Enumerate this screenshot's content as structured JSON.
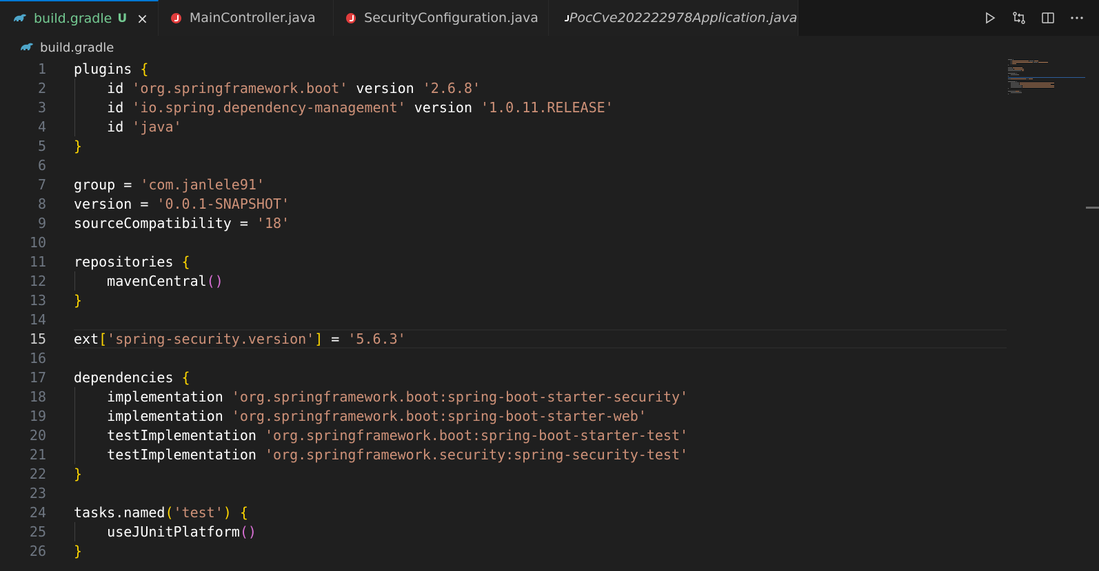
{
  "tabs": [
    {
      "label": "build.gradle",
      "badge": "U",
      "icon": "gradle-icon",
      "active": true,
      "close": "×"
    },
    {
      "label": "MainController.java",
      "icon": "java-icon"
    },
    {
      "label": "SecurityConfiguration.java",
      "icon": "java-icon"
    },
    {
      "label": "PocCve202222978Application.java",
      "icon": "java-icon",
      "italic": true
    }
  ],
  "actions": [
    "run-icon",
    "compare-changes-icon",
    "split-editor-icon",
    "more-actions-icon"
  ],
  "breadcrumb": {
    "file": "build.gradle",
    "icon": "gradle-icon"
  },
  "current_line": 15,
  "colors": {
    "keyword": "#dcdcaa",
    "plain": "#ffffff",
    "string": "#ce9178",
    "brace": "#ffd700",
    "paren": "#da70d6",
    "accent": "#0078d4"
  },
  "lines": [
    {
      "n": "1",
      "tokens": [
        [
          "p",
          "plugins "
        ],
        [
          "b",
          "{"
        ]
      ]
    },
    {
      "n": "2",
      "tokens": [
        [
          "p",
          "    id "
        ],
        [
          "s",
          "'org.springframework.boot'"
        ],
        [
          "p",
          " version "
        ],
        [
          "s",
          "'2.6.8'"
        ]
      ]
    },
    {
      "n": "3",
      "tokens": [
        [
          "p",
          "    id "
        ],
        [
          "s",
          "'io.spring.dependency-management'"
        ],
        [
          "p",
          " version "
        ],
        [
          "s",
          "'1.0.11.RELEASE'"
        ]
      ]
    },
    {
      "n": "4",
      "tokens": [
        [
          "p",
          "    id "
        ],
        [
          "s",
          "'java'"
        ]
      ]
    },
    {
      "n": "5",
      "tokens": [
        [
          "b",
          "}"
        ]
      ]
    },
    {
      "n": "6",
      "tokens": []
    },
    {
      "n": "7",
      "tokens": [
        [
          "p",
          "group = "
        ],
        [
          "s",
          "'com.janlele91'"
        ]
      ]
    },
    {
      "n": "8",
      "tokens": [
        [
          "p",
          "version = "
        ],
        [
          "s",
          "'0.0.1-SNAPSHOT'"
        ]
      ]
    },
    {
      "n": "9",
      "tokens": [
        [
          "p",
          "sourceCompatibility = "
        ],
        [
          "s",
          "'18'"
        ]
      ]
    },
    {
      "n": "10",
      "tokens": []
    },
    {
      "n": "11",
      "tokens": [
        [
          "p",
          "repositories "
        ],
        [
          "b",
          "{"
        ]
      ]
    },
    {
      "n": "12",
      "tokens": [
        [
          "p",
          "    mavenCentral"
        ],
        [
          "q",
          "()"
        ]
      ]
    },
    {
      "n": "13",
      "tokens": [
        [
          "b",
          "}"
        ]
      ]
    },
    {
      "n": "14",
      "tokens": []
    },
    {
      "n": "15",
      "tokens": [
        [
          "p",
          "ext"
        ],
        [
          "b",
          "["
        ],
        [
          "s",
          "'spring-security.version'"
        ],
        [
          "b",
          "]"
        ],
        [
          "p",
          " = "
        ],
        [
          "s",
          "'5.6.3'"
        ]
      ]
    },
    {
      "n": "16",
      "tokens": []
    },
    {
      "n": "17",
      "tokens": [
        [
          "p",
          "dependencies "
        ],
        [
          "b",
          "{"
        ]
      ]
    },
    {
      "n": "18",
      "tokens": [
        [
          "p",
          "    implementation "
        ],
        [
          "s",
          "'org.springframework.boot:spring-boot-starter-security'"
        ]
      ]
    },
    {
      "n": "19",
      "tokens": [
        [
          "p",
          "    implementation "
        ],
        [
          "s",
          "'org.springframework.boot:spring-boot-starter-web'"
        ]
      ]
    },
    {
      "n": "20",
      "tokens": [
        [
          "p",
          "    testImplementation "
        ],
        [
          "s",
          "'org.springframework.boot:spring-boot-starter-test'"
        ]
      ]
    },
    {
      "n": "21",
      "tokens": [
        [
          "p",
          "    testImplementation "
        ],
        [
          "s",
          "'org.springframework.security:spring-security-test'"
        ]
      ]
    },
    {
      "n": "22",
      "tokens": [
        [
          "b",
          "}"
        ]
      ]
    },
    {
      "n": "23",
      "tokens": []
    },
    {
      "n": "24",
      "tokens": [
        [
          "p",
          "tasks.named"
        ],
        [
          "b",
          "("
        ],
        [
          "s",
          "'test'"
        ],
        [
          "b",
          ")"
        ],
        [
          "p",
          " "
        ],
        [
          "b",
          "{"
        ]
      ]
    },
    {
      "n": "25",
      "tokens": [
        [
          "p",
          "    useJUnitPlatform"
        ],
        [
          "q",
          "()"
        ]
      ]
    },
    {
      "n": "26",
      "tokens": [
        [
          "b",
          "}"
        ]
      ]
    }
  ]
}
